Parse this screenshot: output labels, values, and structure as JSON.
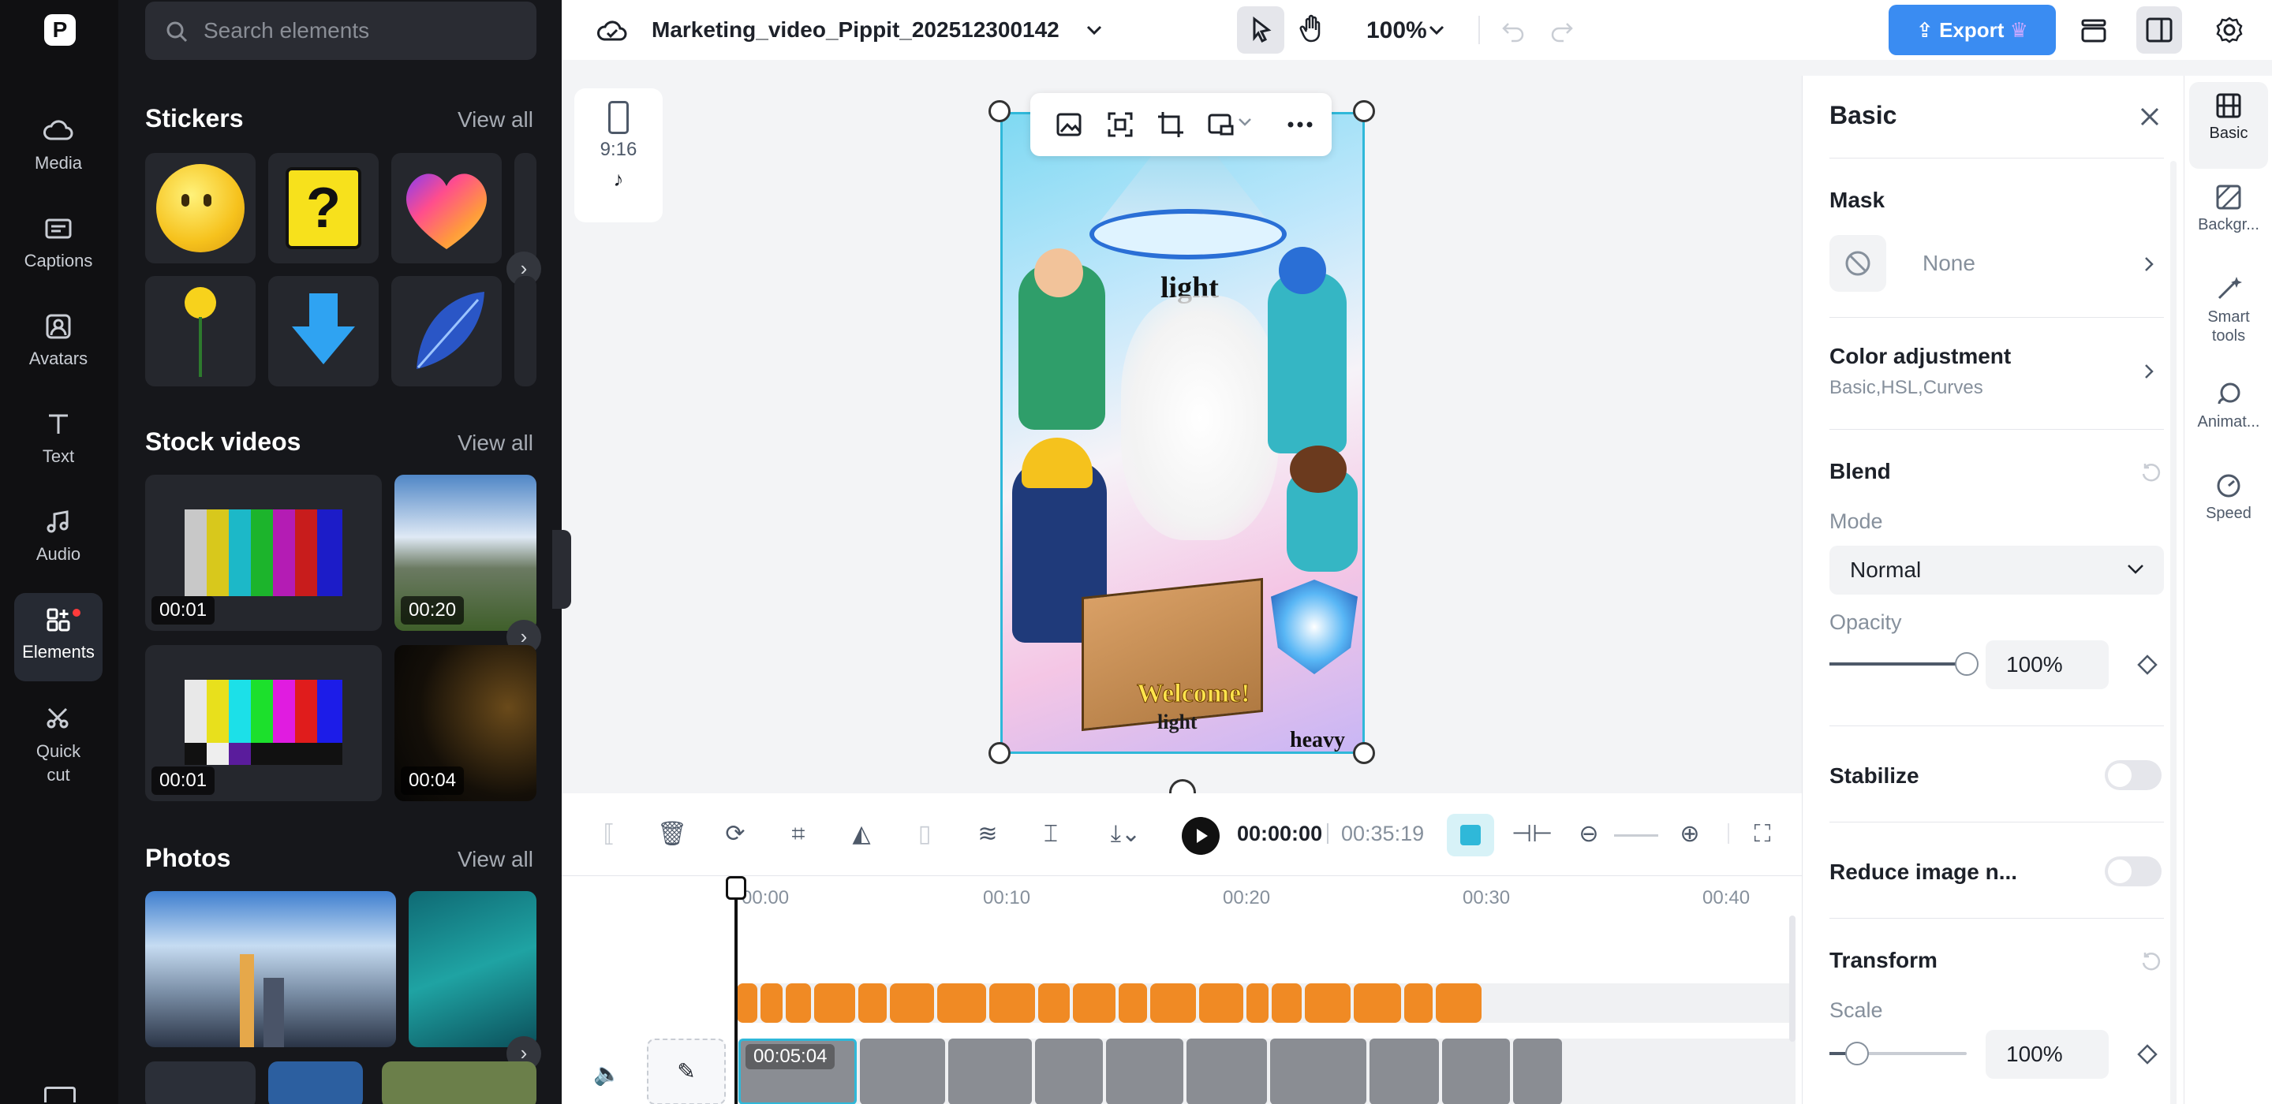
{
  "leftnav": {
    "items": [
      {
        "label": "Media",
        "icon": "cloud-icon"
      },
      {
        "label": "Captions",
        "icon": "captions-icon"
      },
      {
        "label": "Avatars",
        "icon": "avatar-icon"
      },
      {
        "label": "Text",
        "icon": "text-icon"
      },
      {
        "label": "Audio",
        "icon": "music-note-icon"
      },
      {
        "label": "Elements",
        "icon": "elements-icon"
      },
      {
        "label": "Quick cut",
        "icon": "scissors-icon"
      }
    ]
  },
  "panel": {
    "search_placeholder": "Search elements",
    "stickers": {
      "title": "Stickers",
      "view_all": "View all"
    },
    "stock_videos": {
      "title": "Stock videos",
      "view_all": "View all",
      "items": [
        {
          "duration": "00:01"
        },
        {
          "duration": "00:20"
        },
        {
          "duration": "00:01"
        },
        {
          "duration": "00:04"
        }
      ]
    },
    "photos": {
      "title": "Photos",
      "view_all": "View all"
    }
  },
  "topbar": {
    "project_name": "Marketing_video_Pippit_202512300142",
    "zoom": "100%",
    "export_label": "Export"
  },
  "canvas": {
    "aspect_ratio": "9:16",
    "artwork_text": {
      "top": "light",
      "box": "Welcome!",
      "box_sub": "light",
      "bottom": "heavy",
      "badge": "heavy"
    }
  },
  "playbar": {
    "current_time": "00:00:00",
    "total_time": "00:35:19"
  },
  "timeline": {
    "ticks": [
      "00:00",
      "00:10",
      "00:20",
      "00:30",
      "00:40"
    ],
    "clip_duration": "00:05:04"
  },
  "props": {
    "title": "Basic",
    "mask": {
      "label": "Mask",
      "value": "None"
    },
    "color_adjustment": {
      "label": "Color adjustment",
      "sub": "Basic,HSL,Curves"
    },
    "blend": {
      "label": "Blend",
      "mode_label": "Mode",
      "mode_value": "Normal",
      "opacity_label": "Opacity",
      "opacity_value": "100%",
      "opacity_level": 1.0
    },
    "stabilize": {
      "label": "Stabilize",
      "on": false
    },
    "reduce_noise": {
      "label": "Reduce image n...",
      "on": false
    },
    "transform": {
      "label": "Transform",
      "scale_label": "Scale",
      "scale_value": "100%",
      "scale_level": 0.2
    }
  },
  "rtabs": {
    "items": [
      {
        "label": "Basic"
      },
      {
        "label": "Backgr..."
      },
      {
        "label": "Smart tools"
      },
      {
        "label": "Animat..."
      },
      {
        "label": "Speed"
      }
    ]
  },
  "colors": {
    "accent": "#3a8cf2",
    "caption_clip": "#f08a24",
    "selection": "#2fb8d9"
  }
}
